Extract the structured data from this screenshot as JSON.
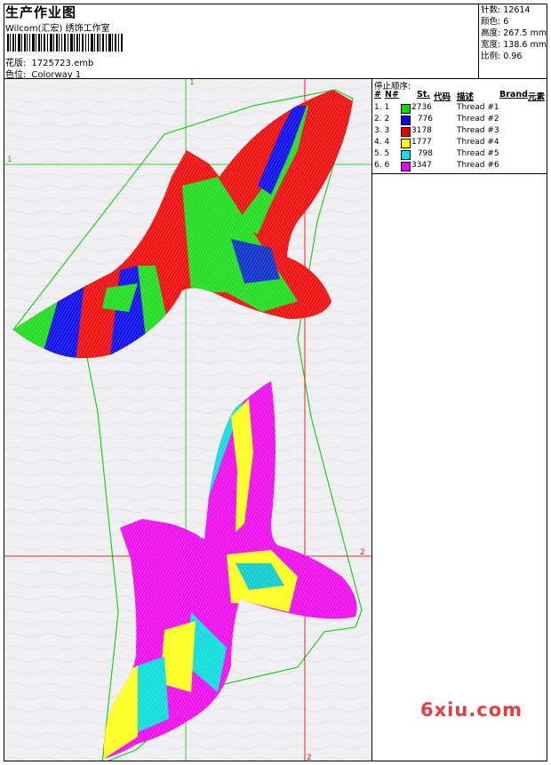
{
  "header": {
    "title": "生产作业图",
    "company": "Wilcom(汇宏) 绣饰工作室",
    "design_label": "花版:",
    "design_value": "1725723.emb",
    "colorway_label": "色位:",
    "colorway_value": "Colorway 1"
  },
  "stats": [
    {
      "label": "针数:",
      "value": "12614"
    },
    {
      "label": "颜色:",
      "value": "6"
    },
    {
      "label": "高度:",
      "value": "267.5 mm"
    },
    {
      "label": "宽度:",
      "value": "138.6 mm"
    },
    {
      "label": "比例:",
      "value": "0.96"
    }
  ],
  "stop_sequence": {
    "title": "停止顺序:",
    "columns": [
      "#",
      "N#",
      "St.",
      "代码",
      "描述",
      "Brand",
      "元素"
    ],
    "rows": [
      {
        "num": "1.",
        "n": "1",
        "color": "#00dd00",
        "stitches": "2736",
        "desc": "Thread #1"
      },
      {
        "num": "2.",
        "n": "2",
        "color": "#0000ee",
        "stitches": "776",
        "desc": "Thread #2"
      },
      {
        "num": "3.",
        "n": "3",
        "color": "#ee0000",
        "stitches": "3178",
        "desc": "Thread #3"
      },
      {
        "num": "4.",
        "n": "4",
        "color": "#ffff00",
        "stitches": "1777",
        "desc": "Thread #4"
      },
      {
        "num": "5.",
        "n": "5",
        "color": "#00e8e8",
        "stitches": "798",
        "desc": "Thread #5"
      },
      {
        "num": "6.",
        "n": "6",
        "color": "#ee00ee",
        "stitches": "3347",
        "desc": "Thread #6"
      }
    ]
  },
  "guides": {
    "green_v": "1",
    "green_h": "1",
    "red_v": "2",
    "red_h": "2"
  },
  "watermark": "6xiu.com"
}
